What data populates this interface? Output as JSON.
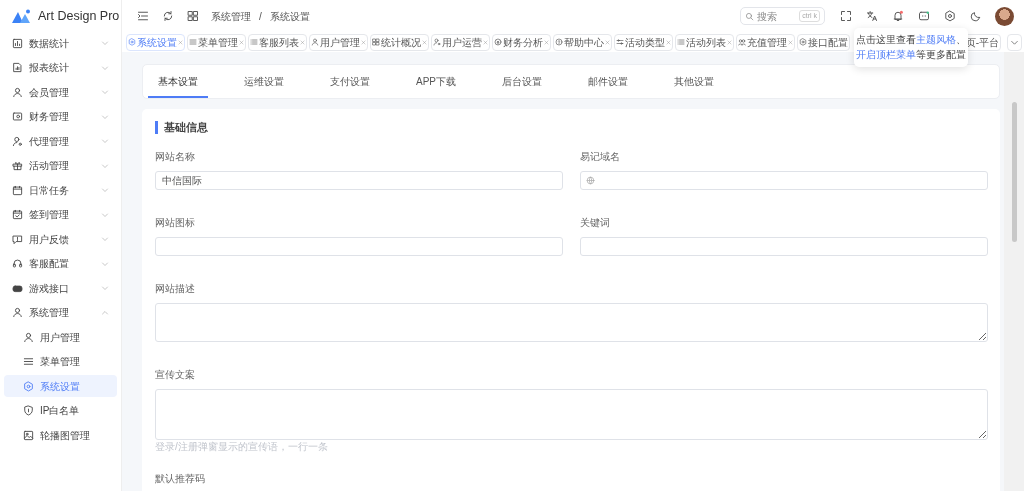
{
  "app": {
    "name": "Art Design Pro"
  },
  "header": {
    "breadcrumb": [
      "系统管理",
      "系统设置"
    ],
    "separator": "/",
    "search": {
      "placeholder": "搜索",
      "shortcut": "ctrl k"
    }
  },
  "tags": [
    {
      "label": "系统设置",
      "selected": true,
      "closable": true
    },
    {
      "label": "菜单管理",
      "selected": false,
      "closable": true
    },
    {
      "label": "客服列表",
      "selected": false,
      "closable": true
    },
    {
      "label": "用户管理",
      "selected": false,
      "closable": true
    },
    {
      "label": "统计概况",
      "selected": false,
      "closable": true
    },
    {
      "label": "用户运营",
      "selected": false,
      "closable": true
    },
    {
      "label": "财务分析",
      "selected": false,
      "closable": true
    },
    {
      "label": "帮助中心",
      "selected": false,
      "closable": true
    },
    {
      "label": "活动类型",
      "selected": false,
      "closable": true
    },
    {
      "label": "活动列表",
      "selected": false,
      "closable": true
    },
    {
      "label": "充值管理",
      "selected": false,
      "closable": true
    },
    {
      "label": "接口配置",
      "selected": false,
      "closable": false
    },
    {
      "label": "页-平台",
      "selected": false,
      "closable": false
    }
  ],
  "tooltip": [
    {
      "text": "点击这里查看"
    },
    {
      "text": "主题风格",
      "link": true
    },
    {
      "text": "、"
    },
    {
      "text": "开启顶栏菜单",
      "link": true,
      "newline": true
    },
    {
      "text": "等更多配置"
    }
  ],
  "sidebar": {
    "items": [
      {
        "label": "数据统计",
        "expanded": false
      },
      {
        "label": "报表统计",
        "expanded": false
      },
      {
        "label": "会员管理",
        "expanded": false
      },
      {
        "label": "财务管理",
        "expanded": false
      },
      {
        "label": "代理管理",
        "expanded": false
      },
      {
        "label": "活动管理",
        "expanded": false
      },
      {
        "label": "日常任务",
        "expanded": false
      },
      {
        "label": "签到管理",
        "expanded": false
      },
      {
        "label": "用户反馈",
        "expanded": false
      },
      {
        "label": "客服配置",
        "expanded": false
      },
      {
        "label": "游戏接口",
        "expanded": false
      },
      {
        "label": "系统管理",
        "expanded": true,
        "children": [
          {
            "label": "用户管理",
            "selected": false
          },
          {
            "label": "菜单管理",
            "selected": false
          },
          {
            "label": "系统设置",
            "selected": true
          },
          {
            "label": "IP白名单",
            "selected": false
          },
          {
            "label": "轮播图管理",
            "selected": false
          }
        ]
      }
    ]
  },
  "settings_tabs": [
    {
      "label": "基本设置",
      "selected": true
    },
    {
      "label": "运维设置",
      "selected": false
    },
    {
      "label": "支付设置",
      "selected": false
    },
    {
      "label": "APP下载",
      "selected": false
    },
    {
      "label": "后台设置",
      "selected": false
    },
    {
      "label": "邮件设置",
      "selected": false
    },
    {
      "label": "其他设置",
      "selected": false
    }
  ],
  "section_title": "基础信息",
  "form_rows": [
    [
      {
        "label": "网站名称",
        "kind": "input",
        "value": "中信国际"
      },
      {
        "label": "易记域名",
        "kind": "link-input"
      }
    ],
    [
      {
        "label": "网站图标",
        "kind": "input"
      },
      {
        "label": "关键词",
        "kind": "input"
      }
    ],
    [
      {
        "label": "网站描述",
        "kind": "textarea"
      }
    ],
    [
      {
        "label": "宣传文案",
        "kind": "textarea",
        "hint": "登录/注册弹窗显示的宣传语，一行一条"
      }
    ],
    [
      {
        "label": "默认推荐码"
      }
    ]
  ]
}
